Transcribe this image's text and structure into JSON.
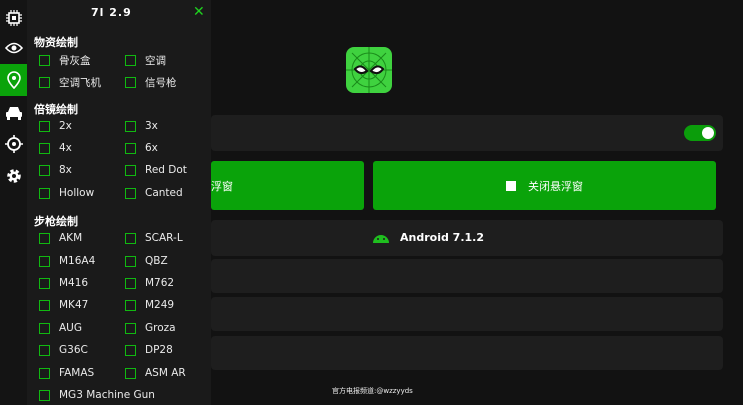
{
  "panel": {
    "title": "7l 2.9",
    "sections": [
      {
        "title": "物资绘制",
        "items": [
          [
            "骨灰盒",
            "空调"
          ],
          [
            "空调飞机",
            "信号枪"
          ]
        ]
      },
      {
        "title": "倍镜绘制",
        "items": [
          [
            "2x",
            "3x"
          ],
          [
            "4x",
            "6x"
          ],
          [
            "8x",
            "Red Dot"
          ],
          [
            "Hollow",
            "Canted"
          ]
        ]
      },
      {
        "title": "步枪绘制",
        "items": [
          [
            "AKM",
            "SCAR-L"
          ],
          [
            "M16A4",
            "QBZ"
          ],
          [
            "M416",
            "M762"
          ],
          [
            "MK47",
            "M249"
          ],
          [
            "AUG",
            "Groza"
          ],
          [
            "G36C",
            "DP28"
          ],
          [
            "FAMAS",
            "ASM AR"
          ],
          [
            "MG3 Machine Gun",
            ""
          ]
        ]
      }
    ]
  },
  "app": {
    "left_button": "浮窗",
    "close_button": "关闭悬浮窗",
    "android_version": "Android 7.1.2",
    "footer": "官方电报频道:@wzzyyds"
  },
  "icons": [
    "cpu-icon",
    "eye-icon",
    "location-icon",
    "car-icon",
    "crosshair-icon",
    "gear-icon"
  ],
  "colors": {
    "accent": "#0aa30a",
    "checkbox": "#11b811"
  }
}
